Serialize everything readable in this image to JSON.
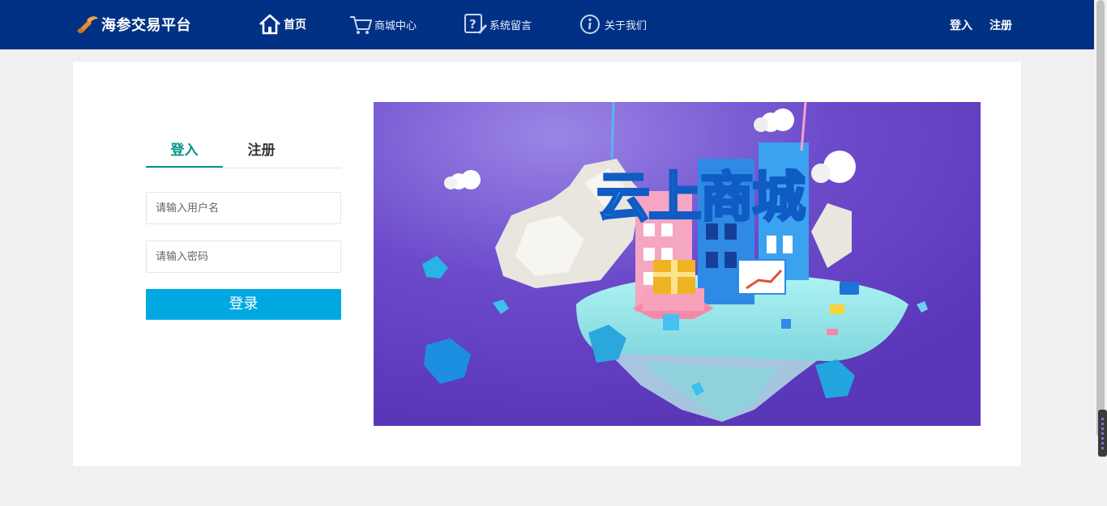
{
  "header": {
    "site_name": "海参交易平台",
    "nav": [
      {
        "label": "首页",
        "icon": "home-icon"
      },
      {
        "label": "商城中心",
        "icon": "cart-icon"
      },
      {
        "label": "系统留言",
        "icon": "message-icon"
      },
      {
        "label": "关于我们",
        "icon": "info-icon"
      }
    ],
    "login_label": "登入",
    "register_label": "注册"
  },
  "auth_form": {
    "tabs": [
      {
        "label": "登入",
        "active": true
      },
      {
        "label": "注册",
        "active": false
      }
    ],
    "username_placeholder": "请输入用户名",
    "password_placeholder": "请输入密码",
    "submit_label": "登录"
  },
  "banner": {
    "headline": "云上商城"
  },
  "colors": {
    "nav_bg": "#013184",
    "accent_tab": "#009688",
    "button": "#00a8e1",
    "banner_bg": "#6a45c8"
  }
}
